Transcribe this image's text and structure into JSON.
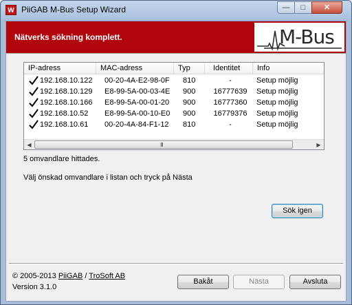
{
  "window": {
    "title": "PiiGAB M-Bus Setup Wizard",
    "app_icon_letter": "W",
    "controls": {
      "minimize": "—",
      "maximize": "□",
      "close": "✕"
    }
  },
  "banner": {
    "heading": "Nätverks sökning komplett.",
    "logo_text": "M-Bus"
  },
  "list": {
    "columns": [
      "IP-adress",
      "MAC-adress",
      "Typ",
      "Identitet",
      "Info"
    ],
    "rows": [
      {
        "ip": "192.168.10.122",
        "mac": "00-20-4A-E2-98-0F",
        "typ": "810",
        "id": "-",
        "info": "Setup möjlig"
      },
      {
        "ip": "192.168.10.129",
        "mac": "E8-99-5A-00-03-4E",
        "typ": "900",
        "id": "16777639",
        "info": "Setup möjlig"
      },
      {
        "ip": "192.168.10.166",
        "mac": "E8-99-5A-00-01-20",
        "typ": "900",
        "id": "16777360",
        "info": "Setup möjlig"
      },
      {
        "ip": "192.168.10.52",
        "mac": "E8-99-5A-00-10-E0",
        "typ": "900",
        "id": "16779376",
        "info": "Setup möjlig"
      },
      {
        "ip": "192.168.10.61",
        "mac": "00-20-4A-84-F1-12",
        "typ": "810",
        "id": "-",
        "info": "Setup möjlig"
      }
    ],
    "scroll": {
      "left_arrow": "◀",
      "right_arrow": "▶",
      "grip": "III"
    }
  },
  "status": {
    "found_text": "5 omvandlare hittades.",
    "instruction": "Välj önskad omvandlare i listan och tryck på Nästa"
  },
  "buttons": {
    "search_again": "Sök igen",
    "back": "Bakåt",
    "next": "Nästa",
    "exit": "Avsluta"
  },
  "footer": {
    "copyright": "© 2005-2013",
    "company1": "PiiGAB",
    "separator": "/",
    "company2": "TroSoft AB",
    "version": "Version 3.1.0"
  }
}
